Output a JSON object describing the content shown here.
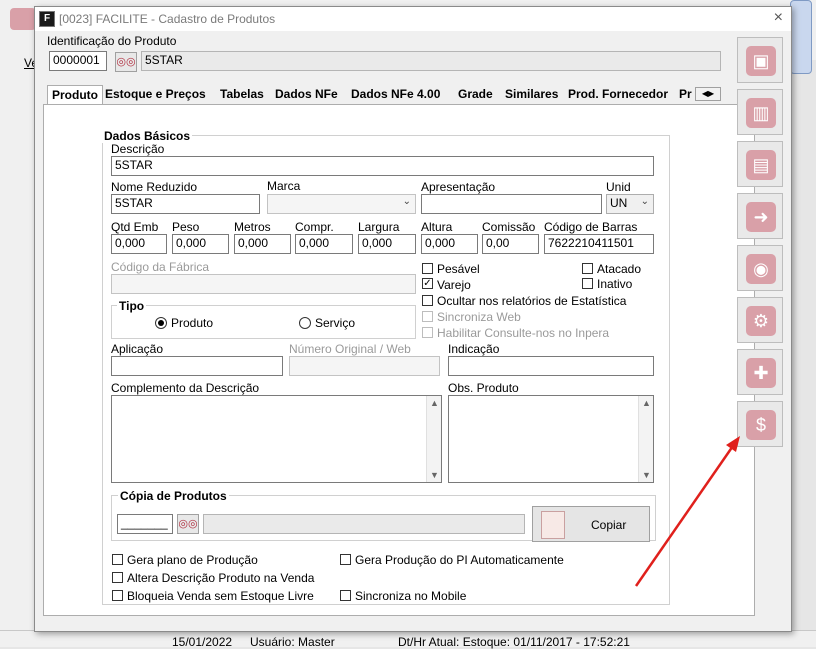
{
  "window": {
    "title": "[0023] FACILITE - Cadastro de Produtos",
    "app_icon": "F",
    "close": "×"
  },
  "background": {
    "left_label": "Ve",
    "status": [
      "15/01/2022",
      "Usuário: Master",
      "Dt/Hr Atual: Estoque: 01/11/2017 - 17:52:21"
    ]
  },
  "ident": {
    "title": "Identificação do Produto",
    "code": "0000001",
    "name": "5STAR",
    "search_icon": "binoculars-icon"
  },
  "tabs": [
    {
      "label": "Produto"
    },
    {
      "label": "Estoque e Preços"
    },
    {
      "label": "Tabelas"
    },
    {
      "label": "Dados NFe"
    },
    {
      "label": "Dados NFe 4.00"
    },
    {
      "label": "Grade"
    },
    {
      "label": "Similares"
    },
    {
      "label": "Prod. Fornecedor"
    },
    {
      "label": "Pr"
    }
  ],
  "tab_nav": {
    "left": "◀",
    "right": "▶"
  },
  "basic": {
    "group_title": "Dados Básicos",
    "descricao_label": "Descrição",
    "descricao": "5STAR",
    "nome_reduzido_label": "Nome Reduzido",
    "nome_reduzido": "5STAR",
    "marca_label": "Marca",
    "marca": "",
    "apresentacao_label": "Apresentação",
    "apresentacao": "",
    "unid_label": "Unid",
    "unid": "UN",
    "qtd_emb_label": "Qtd Emb",
    "qtd_emb": "0,000",
    "peso_label": "Peso",
    "peso": "0,000",
    "metros_label": "Metros",
    "metros": "0,000",
    "compr_label": "Compr.",
    "compr": "0,000",
    "largura_label": "Largura",
    "largura": "0,000",
    "altura_label": "Altura",
    "altura": "0,000",
    "comissao_label": "Comissão",
    "comissao": "0,00",
    "codigo_barras_label": "Código de Barras",
    "codigo_barras": "7622210411501",
    "codigo_fabrica_label": "Código da Fábrica",
    "codigo_fabrica": ""
  },
  "checks": {
    "pesavel": {
      "label": "Pesável",
      "checked": false
    },
    "atacado": {
      "label": "Atacado",
      "checked": false
    },
    "varejo": {
      "label": "Varejo",
      "checked": true
    },
    "inativo": {
      "label": "Inativo",
      "checked": false
    },
    "ocultar": {
      "label": "Ocultar nos relatórios de Estatística",
      "checked": false
    },
    "sincroniza_web": {
      "label": "Sincroniza Web",
      "checked": false
    },
    "consulte": {
      "label": "Habilitar Consulte-nos no Inpera",
      "checked": false
    },
    "check_mark": "✓"
  },
  "tipo": {
    "title": "Tipo",
    "produto": "Produto",
    "servico": "Serviço",
    "selected": "Produto"
  },
  "fields2": {
    "aplicacao_label": "Aplicação",
    "aplicacao": "",
    "numero_original_label": "Número Original / Web",
    "numero_original": "",
    "indicacao_label": "Indicação",
    "indicacao": "",
    "complemento_label": "Complemento da Descrição",
    "obs_label": "Obs. Produto"
  },
  "copia": {
    "title": "Cópia de Produtos",
    "code": "_______",
    "copiar": "Copiar"
  },
  "options": {
    "gera_plano": "Gera plano de Produção",
    "gera_producao": "Gera Produção do PI Automaticamente",
    "altera_descricao": "Altera Descrição Produto na Venda",
    "bloqueia_venda": "Bloqueia Venda sem Estoque Livre",
    "sincroniza_mobile": "Sincroniza no Mobile"
  },
  "sidebar": [
    {
      "icon": "save-icon",
      "glyph": "▣"
    },
    {
      "icon": "trash-icon",
      "glyph": "▥"
    },
    {
      "icon": "printer-icon",
      "glyph": "▤"
    },
    {
      "icon": "exit-door-icon",
      "glyph": "➜"
    },
    {
      "icon": "lifebuoy-icon",
      "glyph": "◉"
    },
    {
      "icon": "settings-gear-icon",
      "glyph": "⚙"
    },
    {
      "icon": "tools-icon",
      "glyph": "✚"
    },
    {
      "icon": "price-tag-icon",
      "glyph": "$"
    }
  ],
  "colors": {
    "annotation_arrow": "#e0201c",
    "sidebar_icon": "#d9a0a8"
  }
}
